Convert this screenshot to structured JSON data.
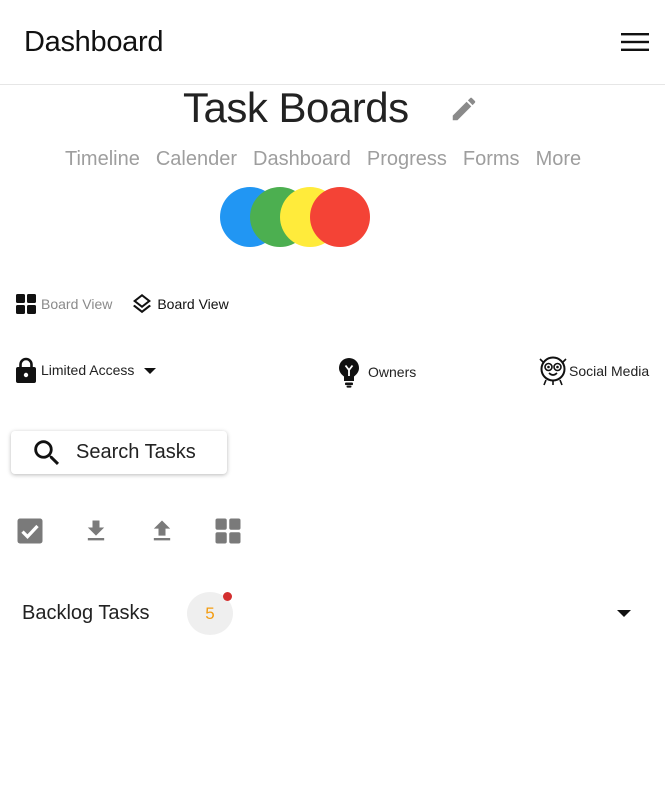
{
  "header": {
    "app_title": "Dashboard",
    "menu_icon": "hamburger-menu-icon"
  },
  "board": {
    "title": "Task Boards",
    "edit_icon": "pencil-icon"
  },
  "tabs": [
    {
      "label": "Timeline"
    },
    {
      "label": "Calender"
    },
    {
      "label": "Dashboard"
    },
    {
      "label": "Progress"
    },
    {
      "label": "Forms"
    },
    {
      "label": "More"
    }
  ],
  "members": {
    "avatar_colors": [
      "#2196f3",
      "#4caf50",
      "#ffeb3b",
      "#f44336"
    ]
  },
  "views": [
    {
      "label": "Board View",
      "icon": "grid-icon",
      "color": "#8a8a8a"
    },
    {
      "label": "Board View",
      "icon": "layers-icon",
      "color": "#111111"
    }
  ],
  "access": {
    "label": "Limited Access",
    "icon": "lock-icon"
  },
  "owners": {
    "label": "Owners",
    "icon": "lightbulb-icon"
  },
  "social": {
    "label": "Social Media",
    "icon": "mascot-icon"
  },
  "search": {
    "label": "Search Tasks",
    "icon": "search-icon"
  },
  "actions": [
    {
      "icon": "checkbox-icon"
    },
    {
      "icon": "download-icon"
    },
    {
      "icon": "upload-icon"
    },
    {
      "icon": "grid-icon"
    }
  ],
  "backlog": {
    "label": "Backlog Tasks",
    "count": "5",
    "count_color": "#f39c12",
    "dot_color": "#d32f2f"
  }
}
